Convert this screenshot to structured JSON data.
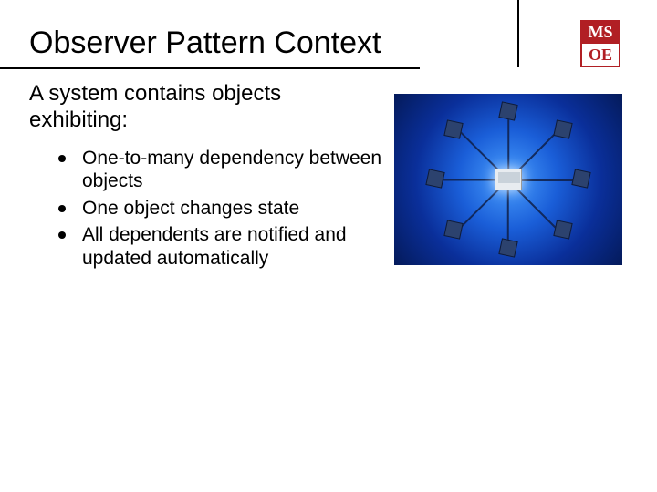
{
  "title": "Observer Pattern Context",
  "logo": {
    "top": "MS",
    "bot": "OE"
  },
  "intro": "A system contains objects exhibiting:",
  "bullets": [
    "One-to-many dependency between objects",
    "One object changes state",
    "All dependents are notified and updated automatically"
  ]
}
